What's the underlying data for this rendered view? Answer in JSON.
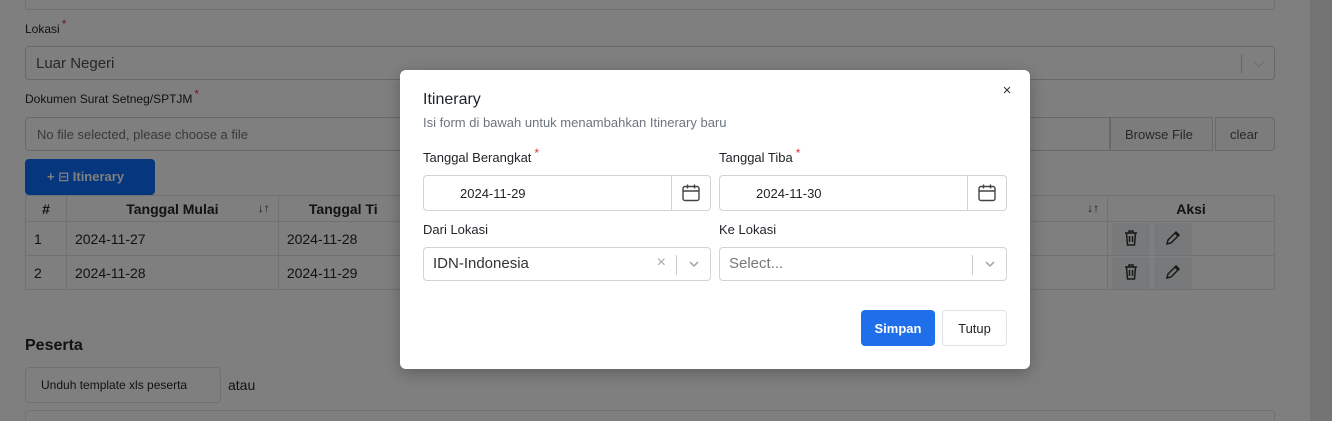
{
  "background": {
    "lokasi_label": "Lokasi",
    "lokasi_value": "Luar Negeri",
    "dokumen_label": "Dokumen Surat Setneg/SPTJM",
    "file_placeholder": "No file selected, please choose a file",
    "browse_label": "Browse File",
    "clear_label": "clear",
    "itinerary_button": "Itinerary",
    "table": {
      "headers": [
        "#",
        "Tanggal Mulai",
        "Tanggal Ti",
        "",
        "Aksi"
      ],
      "rows": [
        {
          "no": "1",
          "mulai": "2024-11-27",
          "tiba": "2024-11-28"
        },
        {
          "no": "2",
          "mulai": "2024-11-28",
          "tiba": "2024-11-29"
        }
      ]
    },
    "peserta_title": "Peserta",
    "unduh_label": "Unduh template xls peserta",
    "atau_label": "atau"
  },
  "modal": {
    "title": "Itinerary",
    "subtitle": "Isi form di bawah untuk menambahkan Itinerary baru",
    "close_symbol": "×",
    "tanggal_berangkat_label": "Tanggal Berangkat",
    "tanggal_berangkat_value": "2024-11-29",
    "tanggal_tiba_label": "Tanggal Tiba",
    "tanggal_tiba_value": "2024-11-30",
    "dari_lokasi_label": "Dari Lokasi",
    "dari_lokasi_value": "IDN-Indonesia",
    "ke_lokasi_label": "Ke Lokasi",
    "ke_lokasi_placeholder": "Select...",
    "simpan_label": "Simpan",
    "tutup_label": "Tutup",
    "required_mark": "*"
  },
  "colors": {
    "primary": "#1f6feb",
    "required": "#dc3545",
    "overlay": "rgba(0,0,0,0.5)"
  }
}
